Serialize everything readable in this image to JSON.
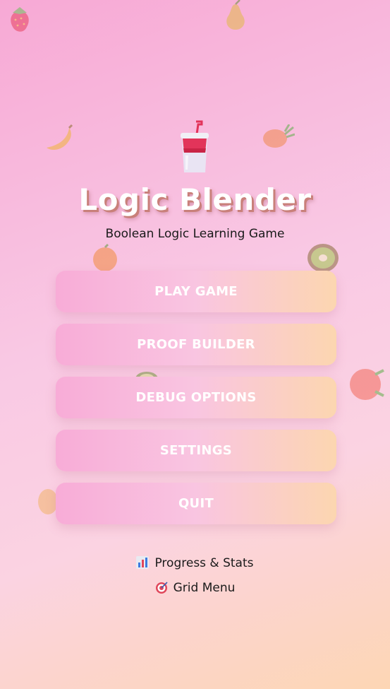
{
  "app": {
    "title": "Logic Blender",
    "subtitle": "Boolean Logic Learning Game"
  },
  "menu": {
    "items": [
      {
        "label": "PLAY GAME"
      },
      {
        "label": "PROOF BUILDER"
      },
      {
        "label": "DEBUG OPTIONS"
      },
      {
        "label": "SETTINGS"
      },
      {
        "label": "QUIT"
      }
    ]
  },
  "links": {
    "progress": {
      "label": "Progress & Stats",
      "icon": "bar-chart-icon"
    },
    "grid": {
      "label": "Grid Menu",
      "icon": "target-icon"
    }
  },
  "icons": [
    "blender-cup-icon",
    "strawberry-icon",
    "pear-icon",
    "banana-icon",
    "pineapple-icon",
    "orange-icon",
    "kiwi-icon",
    "peach-icon",
    "avocado-icon"
  ],
  "colors": {
    "button_start": "#f8acd7",
    "button_end": "#fcd6b0",
    "title_shadow": "#c9807a"
  }
}
